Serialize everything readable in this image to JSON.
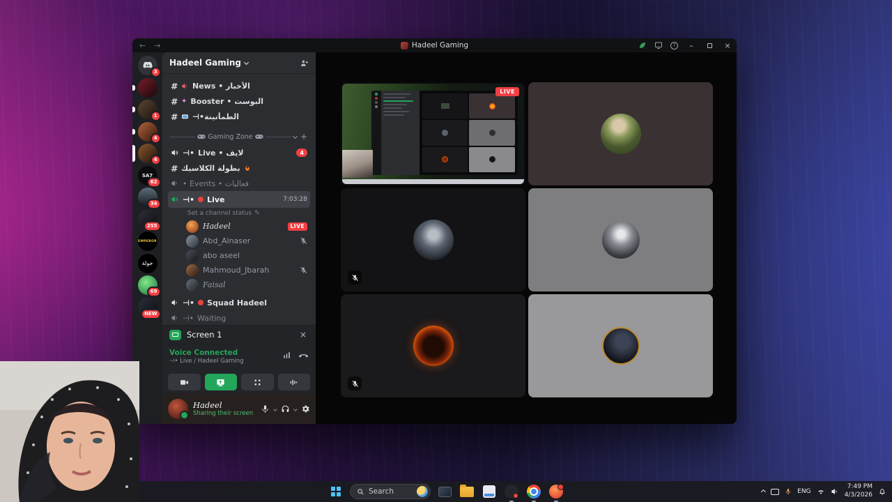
{
  "titlebar": {
    "title": "Hadeel Gaming"
  },
  "rail": {
    "items": [
      {
        "badge": "3"
      },
      {
        "badge": ""
      },
      {
        "badge": "1"
      },
      {
        "badge": "4"
      },
      {
        "badge": "4"
      },
      {
        "label": "SA7",
        "badge": "62"
      },
      {
        "badge": "34"
      },
      {
        "badge": "255"
      },
      {
        "label": "EMPEROR",
        "badge": ""
      },
      {
        "label": "جولة",
        "badge": ""
      },
      {
        "badge": "69"
      },
      {
        "badge": "NEW"
      }
    ]
  },
  "sidebar": {
    "server_name": "Hadeel Gaming",
    "text_channels": [
      {
        "label": "News • الأخبار"
      },
      {
        "label": "Booster • البوست"
      },
      {
        "label": "⊣•الطمأنينة"
      }
    ],
    "category_label": "Gaming Zone",
    "live_channel": {
      "prefix": "⊣•",
      "label": "Live • لايف",
      "badge": "4"
    },
    "classic_channel": {
      "label": "بطولة الكلاسيك"
    },
    "events_channel": {
      "label": "• Events • فعاليات"
    },
    "active_channel": {
      "prefix": "⊣•",
      "name": "Live",
      "timer": "7:03:28",
      "hint": "Set a channel status"
    },
    "members": [
      {
        "name": "Hadeel",
        "badge": "LIVE"
      },
      {
        "name": "Abd_Alnaser"
      },
      {
        "name": "abo aseel"
      },
      {
        "name": "Mahmoud_Jbarah"
      },
      {
        "name": "Faisal"
      }
    ],
    "squad_channel": {
      "prefix": "⊣•",
      "name": "Squad Hadeel"
    },
    "waiting_channel": {
      "prefix": "⊣•",
      "name": "Waiting"
    },
    "screen_panel": {
      "label": "Screen 1"
    },
    "voice_panel": {
      "status": "Voice Connected",
      "detail": "⊣• Live / Hadeel Gaming"
    },
    "user_panel": {
      "name": "Hadeel",
      "status": "Sharing their screen"
    }
  },
  "stage": {
    "live_badge": "LIVE"
  },
  "taskbar": {
    "search_label": "Search",
    "language": "ENG",
    "time": "7:49 PM",
    "date": "4/3/2026"
  }
}
